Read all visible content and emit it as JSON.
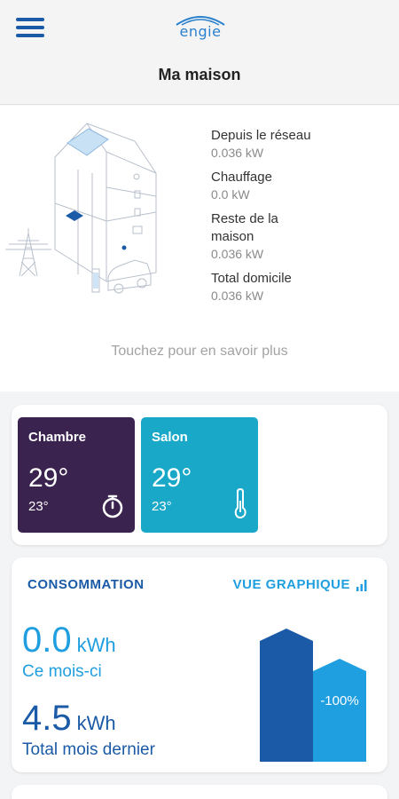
{
  "header": {
    "title": "Ma maison",
    "logo_text": "engie"
  },
  "energy": {
    "items": [
      {
        "label": "Depuis le réseau",
        "value": "0.036 kW"
      },
      {
        "label": "Chauffage",
        "value": "0.0 kW"
      },
      {
        "label": "Reste de la maison",
        "value": "0.036 kW"
      },
      {
        "label": "Total domicile",
        "value": "0.036 kW"
      }
    ],
    "tap_more": "Touchez pour en savoir plus"
  },
  "rooms": [
    {
      "name": "Chambre",
      "temp": "29°",
      "setpoint": "23°",
      "icon": "timer-icon",
      "color": "#3b2350"
    },
    {
      "name": "Salon",
      "temp": "29°",
      "setpoint": "23°",
      "icon": "thermometer-icon",
      "color": "#1aa8c8"
    }
  ],
  "consumption": {
    "title": "CONSOMMATION",
    "graph_link": "VUE GRAPHIQUE",
    "this_month_value": "0.0",
    "this_month_unit": "kWh",
    "this_month_label": "Ce mois-ci",
    "last_month_value": "4.5",
    "last_month_unit": "kWh",
    "last_month_label": "Total mois dernier",
    "change_label": "-100%",
    "colors": {
      "last_month_bar": "#1b5aa6",
      "this_month_bar": "#1f9ee0"
    }
  }
}
